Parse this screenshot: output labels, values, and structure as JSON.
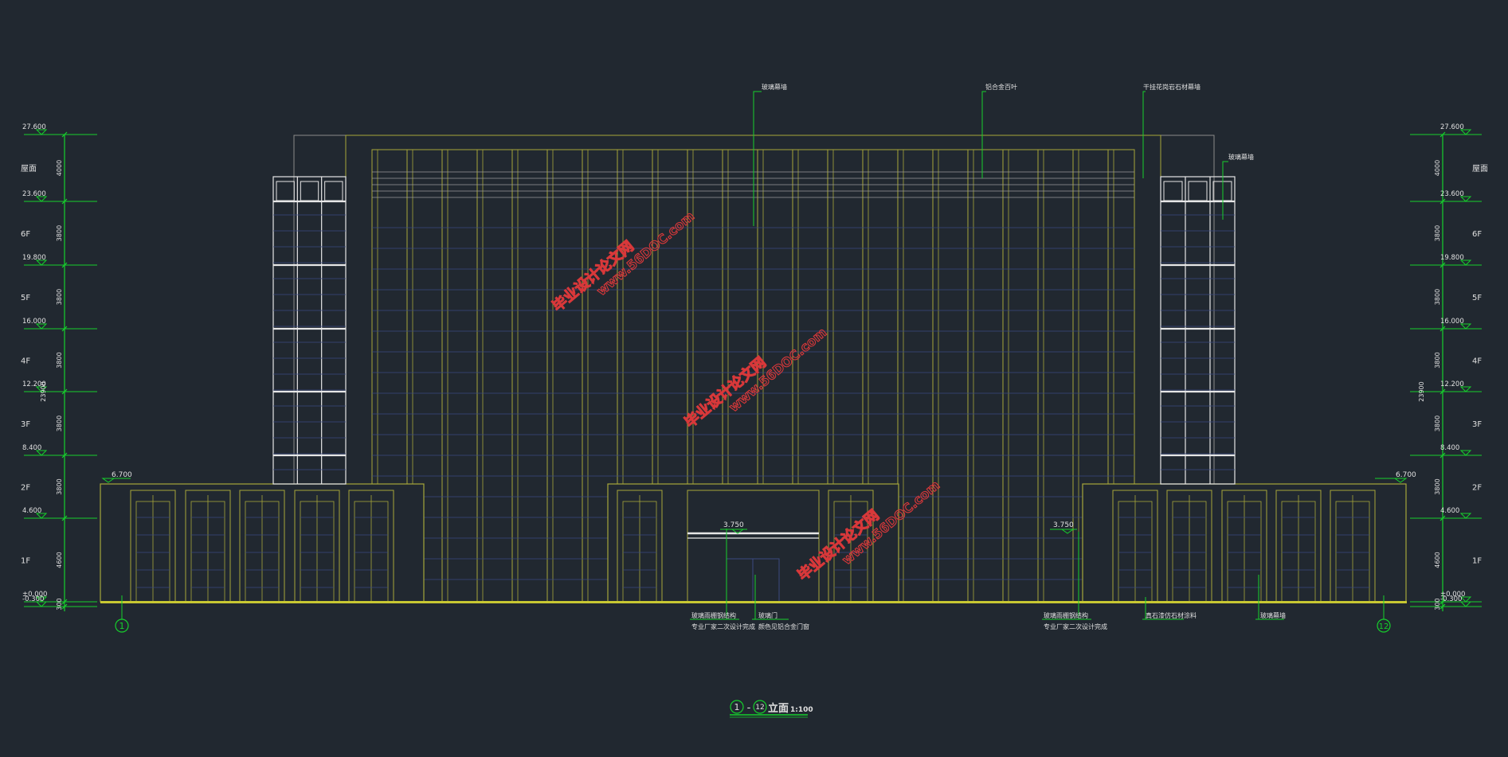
{
  "colors": {
    "background": "#212830",
    "building_outline": "#a6a63a",
    "dimension_lines": "#16d02c",
    "glass_grid": "#3b4a80",
    "frame_white": "#e6e6e6",
    "labels": "#e0e0e0",
    "watermark": "#d8383a",
    "ground": "#c8c832"
  },
  "levels_left": [
    {
      "elev": "27.600",
      "floor": "屋面"
    },
    {
      "elev": "23.600",
      "floor": "6F"
    },
    {
      "elev": "19.800",
      "floor": "5F"
    },
    {
      "elev": "16.000",
      "floor": "4F"
    },
    {
      "elev": "12.200",
      "floor": "3F"
    },
    {
      "elev": "8.400",
      "floor": "2F"
    },
    {
      "elev": "4.600",
      "floor": "1F"
    },
    {
      "elev": "±0.000",
      "floor": ""
    },
    {
      "elev": "-0.300",
      "floor": ""
    }
  ],
  "levels_right": [
    {
      "elev": "27.600",
      "floor": "屋面"
    },
    {
      "elev": "23.600",
      "floor": "6F"
    },
    {
      "elev": "19.800",
      "floor": "5F"
    },
    {
      "elev": "16.000",
      "floor": "4F"
    },
    {
      "elev": "12.200",
      "floor": "3F"
    },
    {
      "elev": "8.400",
      "floor": "2F"
    },
    {
      "elev": "4.600",
      "floor": "1F"
    },
    {
      "elev": "±0.000",
      "floor": ""
    },
    {
      "elev": "-0.300",
      "floor": ""
    }
  ],
  "dims_left": [
    "4000",
    "3800",
    "3800",
    "3800",
    "3800",
    "3800",
    "4600",
    "300"
  ],
  "dims_right": [
    "4000",
    "3800",
    "3800",
    "3800",
    "3800",
    "3800",
    "4600",
    "300"
  ],
  "total_dim": "23900",
  "podium_elev_left": "6.700",
  "podium_elev_right": "6.700",
  "canopy_elev_left": "3.750",
  "canopy_elev_right": "3.750",
  "axes": {
    "left": "1",
    "right": "12"
  },
  "top_notes": [
    {
      "text": "玻璃幕墙"
    },
    {
      "text": "铝合金百叶"
    },
    {
      "text": "干挂花岗岩石材幕墙"
    },
    {
      "text": "玻璃幕墙"
    }
  ],
  "bottom_notes": [
    {
      "line1": "玻璃雨棚钢结构",
      "line2": "专业厂家二次设计完成"
    },
    {
      "line1": "玻璃门",
      "line2": "颜色见铝合金门窗"
    },
    {
      "line1": "玻璃雨棚钢结构",
      "line2": "专业厂家二次设计完成"
    },
    {
      "line1": "真石漆仿石材涂料",
      "line2": ""
    },
    {
      "line1": "玻璃幕墙",
      "line2": ""
    }
  ],
  "title": {
    "axis_from": "1",
    "sep": "-",
    "axis_to": "12",
    "name": "立面",
    "scale": "1:100"
  },
  "watermarks": [
    {
      "brand": "毕业设计论文网",
      "url": "www.56DOC.com"
    },
    {
      "brand": "毕业设计论文网",
      "url": "www.56DOC.com"
    },
    {
      "brand": "毕业设计论文网",
      "url": "www.56DOC.com"
    }
  ]
}
